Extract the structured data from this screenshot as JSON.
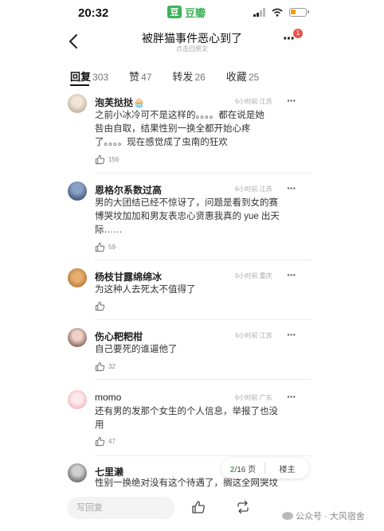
{
  "status_bar": {
    "time": "20:32",
    "app_icon_glyph": "豆",
    "app_name": "豆瓣"
  },
  "nav": {
    "title": "被胖猫事件恶心到了",
    "subtitle": "点击回原文",
    "badge": "1"
  },
  "tabs": [
    {
      "label": "回复",
      "count": "303"
    },
    {
      "label": "赞",
      "count": "47"
    },
    {
      "label": "转发",
      "count": "26"
    },
    {
      "label": "收藏",
      "count": "25"
    }
  ],
  "comments": [
    {
      "name": "泡芙挞挞🧁",
      "meta": "6小时前 江苏",
      "lines": [
        "之前小冰冷可不是这样的。。。。都在说是她",
        "咎由自取，结果性别一换全都开始心疼",
        "了。。。。现在感觉成了虫南的狂欢"
      ],
      "likes": "156"
    },
    {
      "name": "恩格尔系数过高",
      "meta": "6小时前 江苏",
      "lines": [
        "男的大团结已经不惊讶了，问题是看到女的赛",
        "博哭坟加加和男友表忠心贤惠我真的 yue 出天",
        "际……"
      ],
      "likes": "59"
    },
    {
      "name": "杨枝甘露绵绵冰",
      "meta": "6小时前 重庆",
      "lines": [
        "为这种人去死太不值得了"
      ],
      "likes": ""
    },
    {
      "name": "伤心粑粑柑",
      "meta": "6小时前 江苏",
      "lines": [
        "自己要死的谁逼他了"
      ],
      "likes": "32"
    },
    {
      "name": "momo",
      "meta": "6小时前 广东",
      "lines": [
        "还有男的发那个女生的个人信息，举报了也没",
        "用"
      ],
      "likes": "47"
    },
    {
      "name": "七里濑",
      "meta": "",
      "lines": [
        "性别一换绝对没有这个待遇了，搁这全网哭坟"
      ],
      "likes": ""
    }
  ],
  "pager": {
    "current": "2",
    "total_text": "/16 页",
    "op_label": "楼主"
  },
  "bottom": {
    "reply_placeholder": "写回复",
    "watermark": "公众号 · 大风宿舍"
  },
  "colors": {
    "accent": "#3fb25a",
    "badge": "#e8534a"
  }
}
